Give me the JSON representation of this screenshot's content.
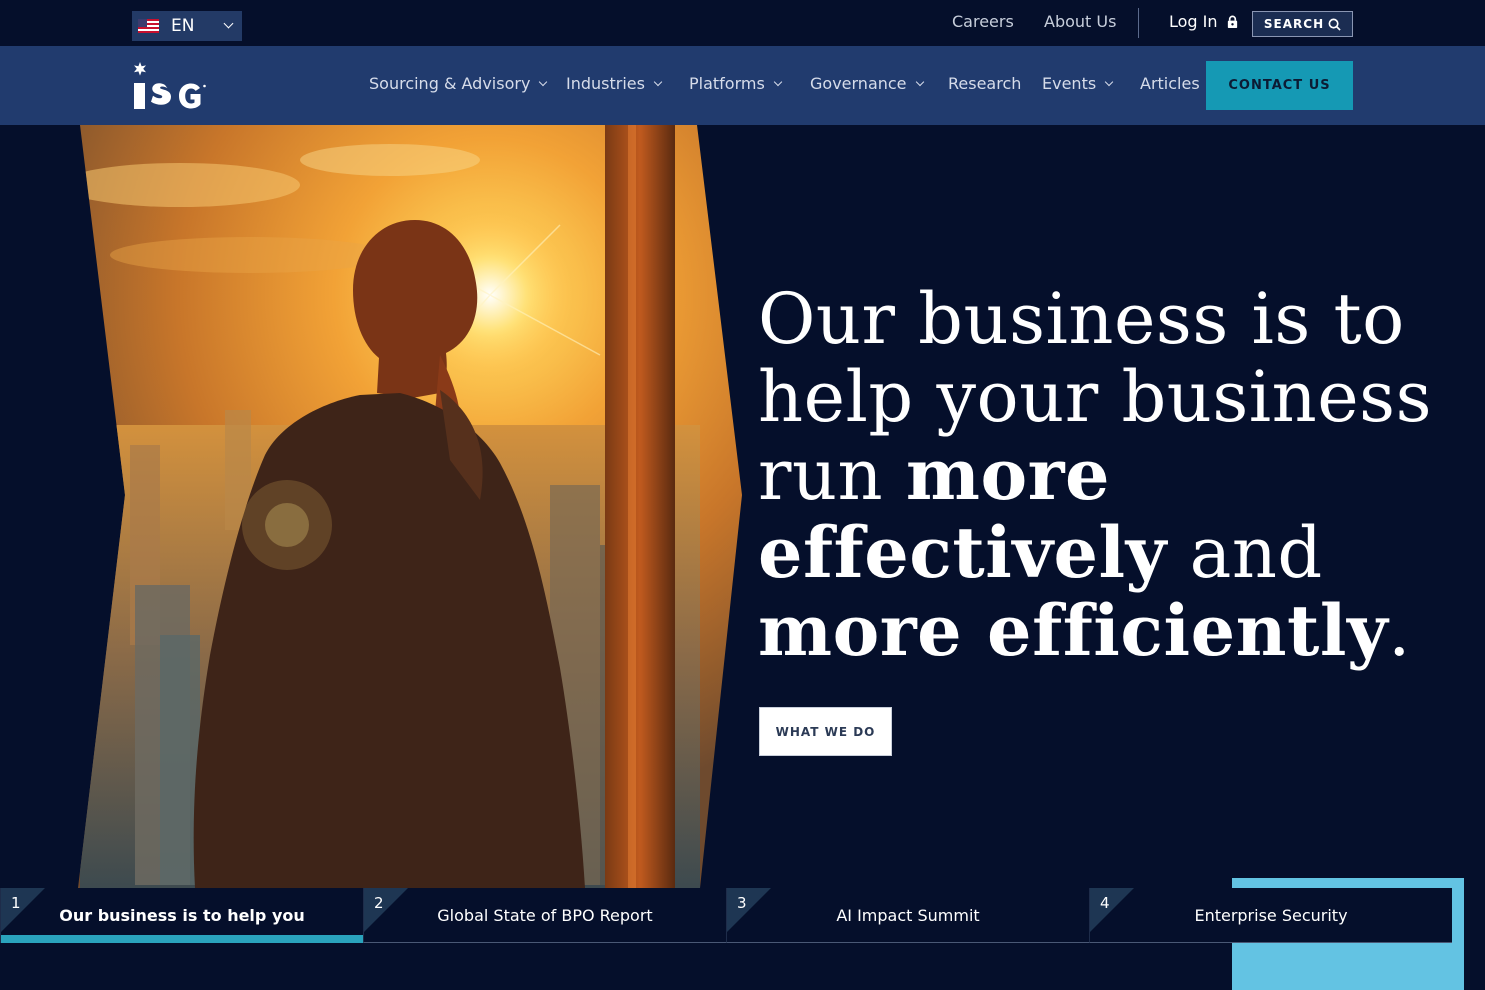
{
  "topbar": {
    "language": "EN",
    "careers": "Careers",
    "about": "About Us",
    "login": "Log In",
    "search": "SEARCH"
  },
  "nav": {
    "items": [
      {
        "label": "Sourcing & Advisory",
        "dropdown": true
      },
      {
        "label": "Industries",
        "dropdown": true
      },
      {
        "label": "Platforms",
        "dropdown": true
      },
      {
        "label": "Governance",
        "dropdown": true
      },
      {
        "label": "Research",
        "dropdown": false
      },
      {
        "label": "Events",
        "dropdown": true
      },
      {
        "label": "Articles",
        "dropdown": false
      }
    ],
    "contact": "CONTACT US"
  },
  "hero": {
    "line1": "Our business is to",
    "line2": "help your business",
    "line3a": "run ",
    "line3b": "more",
    "line4a": "effectively",
    "line4b": " and",
    "line5a": "more efficiently",
    "line5b": ".",
    "cta": "WHAT WE DO"
  },
  "tabs": [
    {
      "num": "1",
      "label": "Our business is to help you"
    },
    {
      "num": "2",
      "label": "Global State of BPO Report"
    },
    {
      "num": "3",
      "label": "AI Impact Summit"
    },
    {
      "num": "4",
      "label": "Enterprise Security"
    }
  ],
  "colors": {
    "background": "#050f2b",
    "nav": "#213b6e",
    "accent": "#1599b4",
    "active_tab": "#2aa3bd"
  }
}
